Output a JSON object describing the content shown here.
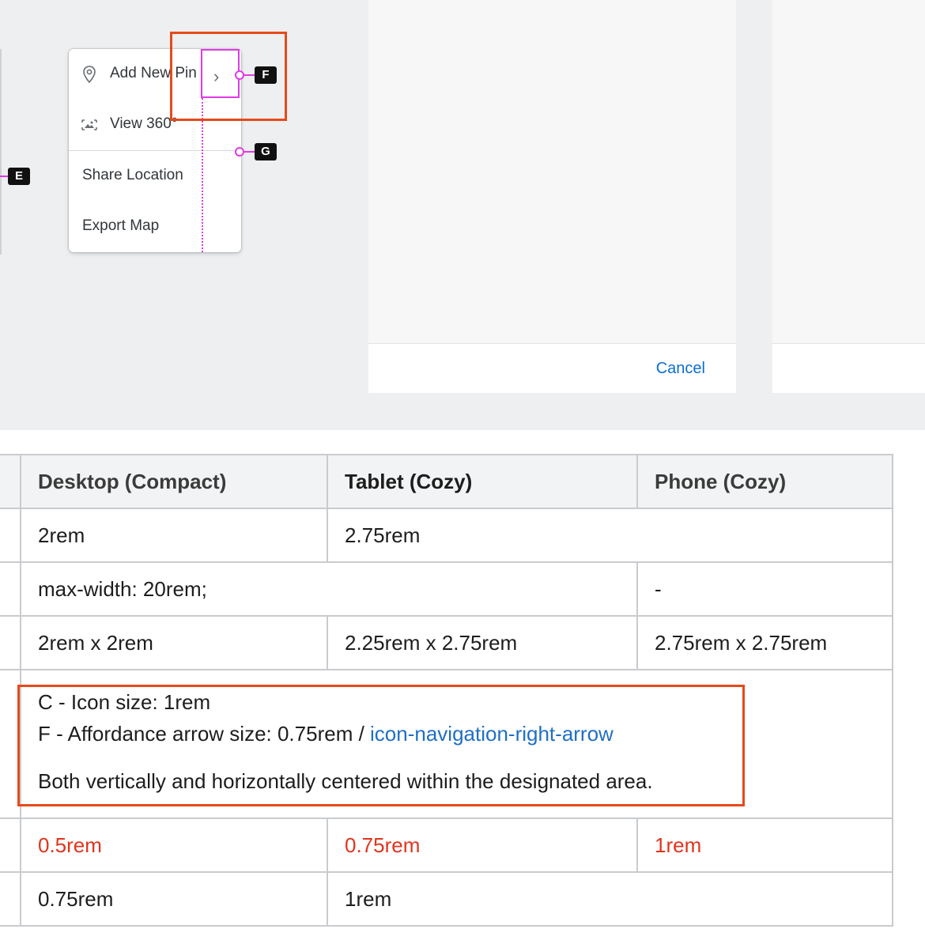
{
  "figure": {
    "menu": {
      "items": [
        {
          "label": "Add New Pin",
          "icon": "map-pin-icon",
          "has_submenu": true
        },
        {
          "label": "View 360°",
          "icon": "panorama-icon"
        },
        {
          "label": "Share Location"
        },
        {
          "label": "Export Map"
        }
      ],
      "submenu_icon": "chevron-right-icon"
    },
    "dialog": {
      "cancel_label": "Cancel"
    },
    "markers": {
      "e": "E",
      "f": "F",
      "g": "G"
    },
    "colors": {
      "highlight": "#e64a19",
      "redline": "#e13ae6",
      "link": "#0a6ed1"
    }
  },
  "table": {
    "headers": [
      "Desktop (Compact)",
      "Tablet (Cozy)",
      "Phone (Cozy)"
    ],
    "rows": [
      {
        "desktop": "2rem",
        "tablet": "2.75rem"
      },
      {
        "desktop": "max-width: 20rem;",
        "phone": "-"
      },
      {
        "desktop": "2rem x 2rem",
        "tablet": "2.25rem x 2.75rem",
        "phone": "2.75rem x 2.75rem"
      },
      {
        "line1": "C - Icon size: 1rem",
        "line2_prefix": "F - Affordance arrow size: 0.75rem / ",
        "line2_link": "icon-navigation-right-arrow",
        "line3": "Both vertically and horizontally centered within the designated area."
      },
      {
        "desktop": "0.5rem",
        "tablet": "0.75rem",
        "phone": "1rem"
      },
      {
        "desktop": "0.75rem",
        "tablet": "1rem"
      }
    ]
  }
}
